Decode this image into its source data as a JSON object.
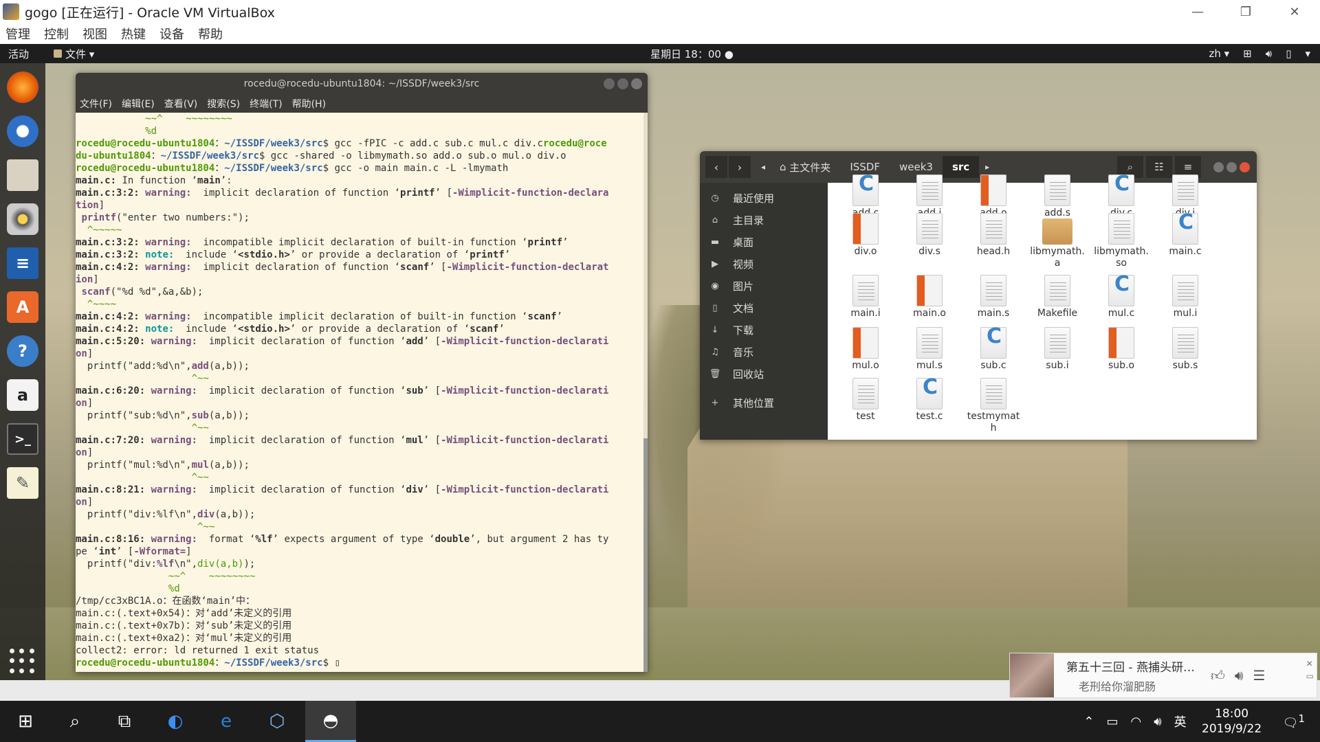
{
  "vbox": {
    "title": "gogo [正在运行] - Oracle VM VirtualBox",
    "menu": [
      "管理",
      "控制",
      "视图",
      "热键",
      "设备",
      "帮助"
    ]
  },
  "gnome": {
    "activities": "活动",
    "app_menu": "文件 ▾",
    "clock": "星期日 18：00",
    "lang": "zh ▾"
  },
  "terminal": {
    "title": "rocedu@rocedu-ubuntu1804: ~/ISSDF/week3/src",
    "menu": [
      "文件(F)",
      "编辑(E)",
      "查看(V)",
      "搜索(S)",
      "终端(T)",
      "帮助(H)"
    ]
  },
  "files": {
    "home_crumb": "主文件夹",
    "crumbs": [
      "ISSDF",
      "week3",
      "src"
    ],
    "sidebar": [
      "最近使用",
      "主目录",
      "桌面",
      "视频",
      "图片",
      "文档",
      "下载",
      "音乐",
      "回收站",
      "其他位置"
    ],
    "items": [
      {
        "name": "add.c",
        "kind": "csrc"
      },
      {
        "name": "add.i",
        "kind": "text"
      },
      {
        "name": "add.o",
        "kind": "obj"
      },
      {
        "name": "add.s",
        "kind": "text"
      },
      {
        "name": "div.c",
        "kind": "csrc"
      },
      {
        "name": "div.i",
        "kind": "text"
      },
      {
        "name": "div.o",
        "kind": "obj"
      },
      {
        "name": "div.s",
        "kind": "text"
      },
      {
        "name": "head.h",
        "kind": "text"
      },
      {
        "name": "libmymath.\na",
        "kind": "lib"
      },
      {
        "name": "libmymath.\nso",
        "kind": "text"
      },
      {
        "name": "main.c",
        "kind": "csrc"
      },
      {
        "name": "main.i",
        "kind": "text"
      },
      {
        "name": "main.o",
        "kind": "obj"
      },
      {
        "name": "main.s",
        "kind": "text"
      },
      {
        "name": "Makefile",
        "kind": "text"
      },
      {
        "name": "mul.c",
        "kind": "csrc"
      },
      {
        "name": "mul.i",
        "kind": "text"
      },
      {
        "name": "mul.o",
        "kind": "obj"
      },
      {
        "name": "mul.s",
        "kind": "text"
      },
      {
        "name": "sub.c",
        "kind": "csrc"
      },
      {
        "name": "sub.i",
        "kind": "text"
      },
      {
        "name": "sub.o",
        "kind": "obj"
      },
      {
        "name": "sub.s",
        "kind": "text"
      },
      {
        "name": "test",
        "kind": "text"
      },
      {
        "name": "test.c",
        "kind": "csrc"
      },
      {
        "name": "testmymat\nh",
        "kind": "text"
      }
    ]
  },
  "music": {
    "title": "第五十三回 - 燕捕头研…",
    "subtitle": "老刑给你溜肥肠"
  },
  "taskbar": {
    "ime": "英",
    "time": "18:00",
    "date": "2019/9/22",
    "notif": "1"
  },
  "colors": {
    "terminal_bg": "#fdf6e3",
    "prompt_user": "#4e9a06",
    "prompt_path": "#3465a4",
    "warning": "#75507b",
    "note": "#06989a",
    "close_btn": "#e0553b"
  },
  "terminal_lines": [
    [
      [
        "g",
        "            ~~^    ~~~~~~~~"
      ]
    ],
    [
      [
        "g",
        "            %d"
      ]
    ],
    [
      [
        "p",
        "rocedu@rocedu-ubuntu1804"
      ],
      [
        "",
        "："
      ],
      [
        "pp",
        "~/ISSDF/week3/src"
      ],
      [
        "",
        "$ gcc -fPIC -c add.c sub.c mul.c div.c"
      ],
      [
        "p",
        "rocedu@roce"
      ]
    ],
    [
      [
        "p",
        "du-ubuntu1804"
      ],
      [
        "",
        "："
      ],
      [
        "pp",
        "~/ISSDF/week3/src"
      ],
      [
        "",
        "$ gcc -shared -o libmymath.so add.o sub.o mul.o div.o"
      ]
    ],
    [
      [
        "p",
        "rocedu@rocedu-ubuntu1804"
      ],
      [
        "",
        "："
      ],
      [
        "pp",
        "~/ISSDF/week3/src"
      ],
      [
        "",
        "$ gcc -o main main.c -L -lmymath"
      ]
    ],
    [
      [
        "b",
        "main.c:"
      ],
      [
        "",
        " In function ‘"
      ],
      [
        "b",
        "main"
      ],
      [
        "",
        "’:"
      ]
    ],
    [
      [
        "b",
        "main.c:3:2: "
      ],
      [
        "w",
        "warning: "
      ],
      [
        "",
        " implicit declaration of function ‘"
      ],
      [
        "b",
        "printf"
      ],
      [
        "",
        "’ ["
      ],
      [
        "w",
        "-Wimplicit-function-declara"
      ]
    ],
    [
      [
        "w",
        "tion"
      ],
      [
        "",
        "]"
      ]
    ],
    [
      [
        "",
        " "
      ],
      [
        "fl",
        "printf"
      ],
      [
        "",
        "(\"enter two numbers:\");"
      ]
    ],
    [
      [
        "g",
        "  ^~~~~~"
      ]
    ],
    [
      [
        "b",
        "main.c:3:2: "
      ],
      [
        "w",
        "warning: "
      ],
      [
        "",
        " incompatible implicit declaration of built-in function ‘"
      ],
      [
        "b",
        "printf"
      ],
      [
        "",
        "’"
      ]
    ],
    [
      [
        "b",
        "main.c:3:2: "
      ],
      [
        "n",
        "note: "
      ],
      [
        "",
        " include ‘"
      ],
      [
        "b",
        "<stdio.h>"
      ],
      [
        "",
        "’ or provide a declaration of ‘"
      ],
      [
        "b",
        "printf"
      ],
      [
        "",
        "’"
      ]
    ],
    [
      [
        "b",
        "main.c:4:2: "
      ],
      [
        "w",
        "warning: "
      ],
      [
        "",
        " implicit declaration of function ‘"
      ],
      [
        "b",
        "scanf"
      ],
      [
        "",
        "’ ["
      ],
      [
        "w",
        "-Wimplicit-function-declarat"
      ]
    ],
    [
      [
        "w",
        "ion"
      ],
      [
        "",
        "]"
      ]
    ],
    [
      [
        "",
        " "
      ],
      [
        "fl",
        "scanf"
      ],
      [
        "",
        "(\"%d %d\",&a,&b);"
      ]
    ],
    [
      [
        "g",
        "  ^~~~~"
      ]
    ],
    [
      [
        "b",
        "main.c:4:2: "
      ],
      [
        "w",
        "warning: "
      ],
      [
        "",
        " incompatible implicit declaration of built-in function ‘"
      ],
      [
        "b",
        "scanf"
      ],
      [
        "",
        "’"
      ]
    ],
    [
      [
        "b",
        "main.c:4:2: "
      ],
      [
        "n",
        "note: "
      ],
      [
        "",
        " include ‘"
      ],
      [
        "b",
        "<stdio.h>"
      ],
      [
        "",
        "’ or provide a declaration of ‘"
      ],
      [
        "b",
        "scanf"
      ],
      [
        "",
        "’"
      ]
    ],
    [
      [
        "b",
        "main.c:5:20: "
      ],
      [
        "w",
        "warning: "
      ],
      [
        "",
        " implicit declaration of function ‘"
      ],
      [
        "b",
        "add"
      ],
      [
        "",
        "’ ["
      ],
      [
        "w",
        "-Wimplicit-function-declarati"
      ]
    ],
    [
      [
        "w",
        "on"
      ],
      [
        "",
        "]"
      ]
    ],
    [
      [
        "",
        "  printf(\"add:%d\\n\","
      ],
      [
        "fl",
        "add"
      ],
      [
        "",
        "(a,b));"
      ]
    ],
    [
      [
        "g",
        "                    ^~~"
      ]
    ],
    [
      [
        "b",
        "main.c:6:20: "
      ],
      [
        "w",
        "warning: "
      ],
      [
        "",
        " implicit declaration of function ‘"
      ],
      [
        "b",
        "sub"
      ],
      [
        "",
        "’ ["
      ],
      [
        "w",
        "-Wimplicit-function-declarati"
      ]
    ],
    [
      [
        "w",
        "on"
      ],
      [
        "",
        "]"
      ]
    ],
    [
      [
        "",
        "  printf(\"sub:%d\\n\","
      ],
      [
        "fl",
        "sub"
      ],
      [
        "",
        "(a,b));"
      ]
    ],
    [
      [
        "g",
        "                    ^~~"
      ]
    ],
    [
      [
        "b",
        "main.c:7:20: "
      ],
      [
        "w",
        "warning: "
      ],
      [
        "",
        " implicit declaration of function ‘"
      ],
      [
        "b",
        "mul"
      ],
      [
        "",
        "’ ["
      ],
      [
        "w",
        "-Wimplicit-function-declarati"
      ]
    ],
    [
      [
        "w",
        "on"
      ],
      [
        "",
        "]"
      ]
    ],
    [
      [
        "",
        "  printf(\"mul:%d\\n\","
      ],
      [
        "fl",
        "mul"
      ],
      [
        "",
        "(a,b));"
      ]
    ],
    [
      [
        "g",
        "                    ^~~"
      ]
    ],
    [
      [
        "b",
        "main.c:8:21: "
      ],
      [
        "w",
        "warning: "
      ],
      [
        "",
        " implicit declaration of function ‘"
      ],
      [
        "b",
        "div"
      ],
      [
        "",
        "’ ["
      ],
      [
        "w",
        "-Wimplicit-function-declarati"
      ]
    ],
    [
      [
        "w",
        "on"
      ],
      [
        "",
        "]"
      ]
    ],
    [
      [
        "",
        "  printf(\"div:%lf\\n\","
      ],
      [
        "fl",
        "div"
      ],
      [
        "",
        "(a,b));"
      ]
    ],
    [
      [
        "g",
        "                     ^~~"
      ]
    ],
    [
      [
        "b",
        "main.c:8:16: "
      ],
      [
        "w",
        "warning: "
      ],
      [
        "",
        " format ‘"
      ],
      [
        "b",
        "%lf"
      ],
      [
        "",
        "’ expects argument of type ‘"
      ],
      [
        "b",
        "double"
      ],
      [
        "",
        "’, but argument 2 has ty"
      ]
    ],
    [
      [
        "",
        "pe ‘"
      ],
      [
        "b",
        "int"
      ],
      [
        "",
        "’ ["
      ],
      [
        "w",
        "-Wformat="
      ],
      [
        "",
        "]"
      ]
    ],
    [
      [
        "",
        "  printf(\"div:"
      ],
      [
        "fl",
        "%lf"
      ],
      [
        "",
        "\\n\","
      ],
      [
        "g",
        "div(a,b)"
      ],
      [
        "",
        ");"
      ]
    ],
    [
      [
        "g",
        "                ~~^    ~~~~~~~~"
      ]
    ],
    [
      [
        "g",
        "                %d"
      ]
    ],
    [
      [
        "",
        "/tmp/cc3xBC1A.o：在函数‘main’中："
      ]
    ],
    [
      [
        "",
        "main.c:(.text+0x54)：对‘add’未定义的引用"
      ]
    ],
    [
      [
        "",
        "main.c:(.text+0x7b)：对‘sub’未定义的引用"
      ]
    ],
    [
      [
        "",
        "main.c:(.text+0xa2)：对‘mul’未定义的引用"
      ]
    ],
    [
      [
        "",
        "collect2: error: ld returned 1 exit status"
      ]
    ],
    [
      [
        "p",
        "rocedu@rocedu-ubuntu1804"
      ],
      [
        "",
        "："
      ],
      [
        "pp",
        "~/ISSDF/week3/src"
      ],
      [
        "",
        "$ ▯"
      ]
    ]
  ]
}
